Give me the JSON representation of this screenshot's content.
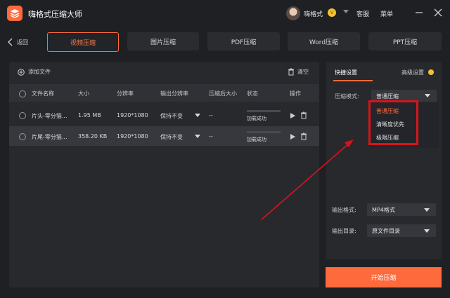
{
  "app": {
    "title": "嗨格式压缩大师",
    "username": "嗨格式",
    "vip_badge": "V",
    "service": "客服",
    "menu": "菜单"
  },
  "nav": {
    "back": "返回",
    "tabs": [
      {
        "label": "视频压缩",
        "active": true
      },
      {
        "label": "图片压缩",
        "active": false
      },
      {
        "label": "PDF压缩",
        "active": false
      },
      {
        "label": "Word压缩",
        "active": false
      },
      {
        "label": "PPT压缩",
        "active": false
      }
    ]
  },
  "file_list": {
    "add_file": "添加文件",
    "clear": "清空",
    "columns": [
      "文件名称",
      "大小",
      "分辨率",
      "输出分辨率",
      "压缩后大小",
      "状态",
      "操作"
    ],
    "rows": [
      {
        "name": "片头-零分猫...",
        "size": "1.95 MB",
        "resolution": "1920*1080",
        "output_resolution": "保持不变",
        "compressed_size": "--",
        "status": "加载成功",
        "progress": 0.0
      },
      {
        "name": "片尾-零分猫...",
        "size": "358.20 KB",
        "resolution": "1920*1080",
        "output_resolution": "保持不变",
        "compressed_size": "--",
        "status": "加载成功",
        "progress": 0.0
      }
    ]
  },
  "settings": {
    "tab_quick": "快捷设置",
    "tab_advanced": "高级设置",
    "mode_label": "压缩模式:",
    "mode_value": "普通压缩",
    "mode_options": [
      "普通压缩",
      "清晰度优先",
      "极限压缩"
    ],
    "output_format_label": "输出格式:",
    "output_format_value": "MP4格式",
    "output_dir_label": "输出目录:",
    "output_dir_value": "原文件目录",
    "start_button": "开始压缩"
  },
  "colors": {
    "accent": "#ff6a3d",
    "highlight": "#d8141a",
    "vip": "#f2c230"
  }
}
